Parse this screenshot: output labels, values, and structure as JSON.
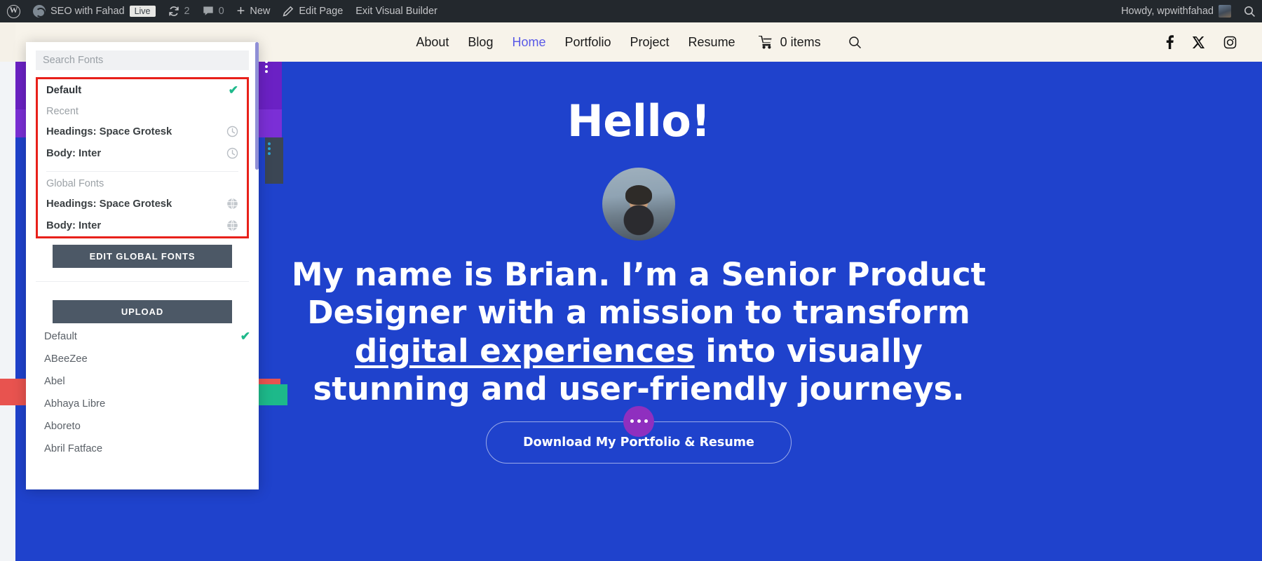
{
  "adminbar": {
    "wp_logo_icon": "wordpress-logo-icon",
    "site_icon": "site-dashboard-icon",
    "site_name": "SEO with Fahad",
    "live_badge": "Live",
    "updates_icon": "updates-icon",
    "updates_count": "2",
    "comments_icon": "comments-icon",
    "comments_count": "0",
    "new_icon": "plus-icon",
    "new_label": "New",
    "edit_icon": "pencil-icon",
    "edit_label": "Edit Page",
    "exit_label": "Exit Visual Builder",
    "howdy": "Howdy, wpwithfahad",
    "avatar_icon": "user-avatar",
    "search_icon": "search-icon"
  },
  "site_header": {
    "nav": [
      {
        "label": "About",
        "current": false
      },
      {
        "label": "Blog",
        "current": false
      },
      {
        "label": "Home",
        "current": true
      },
      {
        "label": "Portfolio",
        "current": false
      },
      {
        "label": "Project",
        "current": false
      },
      {
        "label": "Resume",
        "current": false
      }
    ],
    "cart_icon": "shopping-cart-icon",
    "cart_label": "0 items",
    "search_icon": "search-icon",
    "socials": [
      {
        "name": "facebook-icon",
        "glyph": "f"
      },
      {
        "name": "x-twitter-icon",
        "glyph": "X"
      },
      {
        "name": "instagram-icon",
        "glyph": "IG"
      }
    ]
  },
  "hero": {
    "heading": "Hello!",
    "avatar_icon": "profile-photo",
    "tagline_part1": "My name is Brian. I’m a Senior Product Designer with a mission to transform ",
    "tagline_link": "digital experiences",
    "tagline_part2": " into visually stunning and user-friendly journeys.",
    "cta_label": "Download My Portfolio & Resume",
    "drag_handle_icon": "drag-dots-handle"
  },
  "font_panel": {
    "search": {
      "placeholder": "Search Fonts",
      "value": ""
    },
    "highlighted_section": {
      "default_row": {
        "label": "Default",
        "icon": "check-icon"
      },
      "recent_label": "Recent",
      "recent_items": [
        {
          "label": "Headings: Space Grotesk",
          "icon": "clock-icon"
        },
        {
          "label": "Body: Inter",
          "icon": "clock-icon"
        }
      ],
      "global_label": "Global Fonts",
      "global_items": [
        {
          "label": "Headings: Space Grotesk",
          "icon": "globe-icon"
        },
        {
          "label": "Body: Inter",
          "icon": "globe-icon"
        }
      ]
    },
    "edit_global_fonts_label": "EDIT GLOBAL FONTS",
    "upload_label": "UPLOAD",
    "font_list": [
      {
        "label": "Default",
        "icon": "check-icon",
        "selected": true
      },
      {
        "label": "ABeeZee",
        "icon": "",
        "selected": false
      },
      {
        "label": "Abel",
        "icon": "",
        "selected": false
      },
      {
        "label": "Abhaya Libre",
        "icon": "",
        "selected": false
      },
      {
        "label": "Aboreto",
        "icon": "",
        "selected": false
      },
      {
        "label": "Abril Fatface",
        "icon": "",
        "selected": false
      }
    ]
  },
  "colors": {
    "admin_bar_bg": "#23282d",
    "hero_bg": "#1f42cc",
    "header_bg": "#f7f3ea",
    "accent_check": "#1fb98b",
    "highlight_border": "#e8201a",
    "button_dark": "#4c5866",
    "nav_current": "#5a5ae6",
    "handle_purple": "#8f2fbf"
  }
}
